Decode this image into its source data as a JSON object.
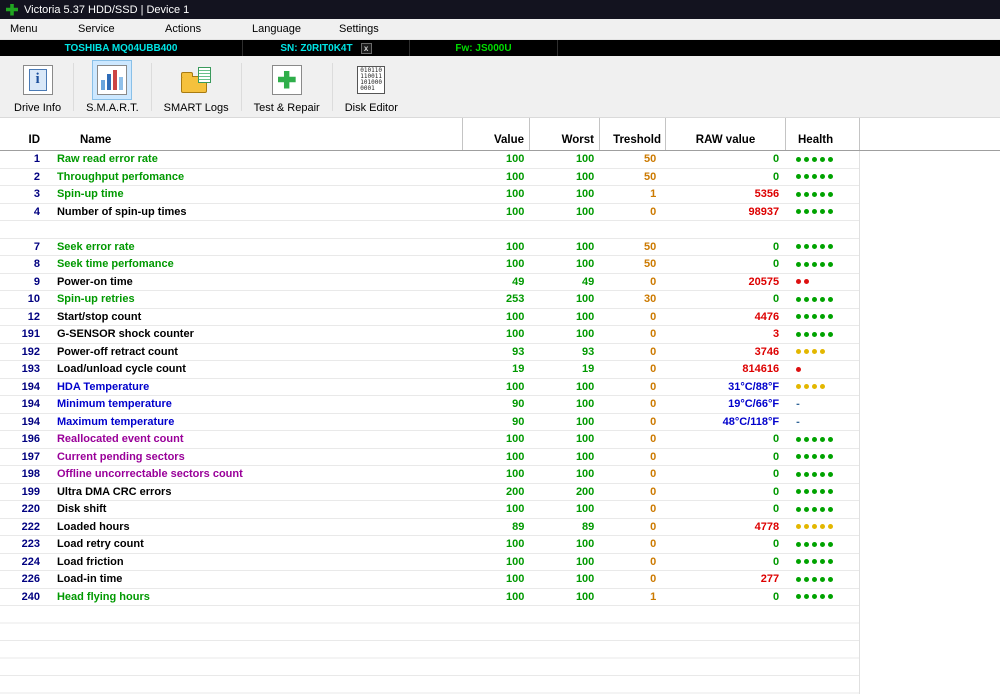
{
  "window": {
    "title": "Victoria 5.37 HDD/SSD | Device 1"
  },
  "menu": {
    "items": [
      "Menu",
      "Service",
      "Actions",
      "Language",
      "Settings"
    ]
  },
  "drive_bar": {
    "model": "TOSHIBA MQ04UBB400",
    "serial": "SN: Z0RIT0K4T",
    "close": "x",
    "firmware": "Fw: JS000U"
  },
  "toolbar": {
    "buttons": [
      {
        "label": "Drive Info",
        "icon": "info-icon",
        "glyph": "i"
      },
      {
        "label": "S.M.A.R.T.",
        "icon": "smart-chart-icon",
        "selected": true
      },
      {
        "label": "SMART Logs",
        "icon": "folder-logs-icon"
      },
      {
        "label": "Test & Repair",
        "icon": "repair-cross-icon"
      },
      {
        "label": "Disk Editor",
        "icon": "binary-editor-icon",
        "icon_text": [
          "010110",
          "110011",
          "101000",
          "0001"
        ]
      }
    ]
  },
  "table": {
    "headers": [
      "ID",
      "Name",
      "Value",
      "Worst",
      "Treshold",
      "RAW value",
      "Health"
    ],
    "rows": [
      {
        "id": "1",
        "name": "Raw read error rate",
        "name_color": "green",
        "value": "100",
        "worst": "100",
        "threshold": "50",
        "raw": "0",
        "raw_color": "green",
        "health": {
          "dots": 5,
          "color": "green"
        }
      },
      {
        "id": "2",
        "name": "Throughput perfomance",
        "name_color": "green",
        "value": "100",
        "worst": "100",
        "threshold": "50",
        "raw": "0",
        "raw_color": "green",
        "health": {
          "dots": 5,
          "color": "green"
        }
      },
      {
        "id": "3",
        "name": "Spin-up time",
        "name_color": "green",
        "value": "100",
        "worst": "100",
        "threshold": "1",
        "raw": "5356",
        "raw_color": "red",
        "health": {
          "dots": 5,
          "color": "green"
        }
      },
      {
        "id": "4",
        "name": "Number of spin-up times",
        "name_color": "black",
        "value": "100",
        "worst": "100",
        "threshold": "0",
        "raw": "98937",
        "raw_color": "red",
        "health": {
          "dots": 5,
          "color": "green"
        }
      },
      {
        "spacer": true
      },
      {
        "id": "7",
        "name": "Seek error rate",
        "name_color": "green",
        "value": "100",
        "worst": "100",
        "threshold": "50",
        "raw": "0",
        "raw_color": "green",
        "health": {
          "dots": 5,
          "color": "green"
        }
      },
      {
        "id": "8",
        "name": "Seek time perfomance",
        "name_color": "green",
        "value": "100",
        "worst": "100",
        "threshold": "50",
        "raw": "0",
        "raw_color": "green",
        "health": {
          "dots": 5,
          "color": "green"
        }
      },
      {
        "id": "9",
        "name": "Power-on time",
        "name_color": "black",
        "value": "49",
        "worst": "49",
        "threshold": "0",
        "raw": "20575",
        "raw_color": "red",
        "health": {
          "dots": 2,
          "color": "red"
        }
      },
      {
        "id": "10",
        "name": "Spin-up retries",
        "name_color": "green",
        "value": "253",
        "worst": "100",
        "threshold": "30",
        "raw": "0",
        "raw_color": "green",
        "health": {
          "dots": 5,
          "color": "green"
        }
      },
      {
        "id": "12",
        "name": "Start/stop count",
        "name_color": "black",
        "value": "100",
        "worst": "100",
        "threshold": "0",
        "raw": "4476",
        "raw_color": "red",
        "health": {
          "dots": 5,
          "color": "green"
        }
      },
      {
        "id": "191",
        "name": "G-SENSOR shock counter",
        "name_color": "black",
        "value": "100",
        "worst": "100",
        "threshold": "0",
        "raw": "3",
        "raw_color": "red",
        "health": {
          "dots": 5,
          "color": "green"
        }
      },
      {
        "id": "192",
        "name": "Power-off retract count",
        "name_color": "black",
        "value": "93",
        "worst": "93",
        "threshold": "0",
        "raw": "3746",
        "raw_color": "red",
        "health": {
          "dots": 4,
          "color": "yellow"
        }
      },
      {
        "id": "193",
        "name": "Load/unload cycle count",
        "name_color": "black",
        "value": "19",
        "worst": "19",
        "threshold": "0",
        "raw": "814616",
        "raw_color": "red",
        "health": {
          "dots": 1,
          "color": "red"
        }
      },
      {
        "id": "194",
        "name": "HDA Temperature",
        "name_color": "blue",
        "value": "100",
        "worst": "100",
        "threshold": "0",
        "raw": "31°C/88°F",
        "raw_color": "blue",
        "health": {
          "dots": 4,
          "color": "yellow"
        }
      },
      {
        "id": "194",
        "name": "Minimum temperature",
        "name_color": "blue",
        "value": "90",
        "worst": "100",
        "threshold": "0",
        "raw": "19°C/66°F",
        "raw_color": "blue",
        "health": {
          "dash": true
        }
      },
      {
        "id": "194",
        "name": "Maximum temperature",
        "name_color": "blue",
        "value": "90",
        "worst": "100",
        "threshold": "0",
        "raw": "48°C/118°F",
        "raw_color": "blue",
        "health": {
          "dash": true
        }
      },
      {
        "id": "196",
        "name": "Reallocated event count",
        "name_color": "purple",
        "value": "100",
        "worst": "100",
        "threshold": "0",
        "raw": "0",
        "raw_color": "green",
        "health": {
          "dots": 5,
          "color": "green"
        }
      },
      {
        "id": "197",
        "name": "Current pending sectors",
        "name_color": "purple",
        "value": "100",
        "worst": "100",
        "threshold": "0",
        "raw": "0",
        "raw_color": "green",
        "health": {
          "dots": 5,
          "color": "green"
        }
      },
      {
        "id": "198",
        "name": "Offline uncorrectable sectors count",
        "name_color": "purple",
        "value": "100",
        "worst": "100",
        "threshold": "0",
        "raw": "0",
        "raw_color": "green",
        "health": {
          "dots": 5,
          "color": "green"
        }
      },
      {
        "id": "199",
        "name": "Ultra DMA CRC errors",
        "name_color": "black",
        "value": "200",
        "worst": "200",
        "threshold": "0",
        "raw": "0",
        "raw_color": "green",
        "health": {
          "dots": 5,
          "color": "green"
        }
      },
      {
        "id": "220",
        "name": "Disk shift",
        "name_color": "black",
        "value": "100",
        "worst": "100",
        "threshold": "0",
        "raw": "0",
        "raw_color": "green",
        "health": {
          "dots": 5,
          "color": "green"
        }
      },
      {
        "id": "222",
        "name": "Loaded hours",
        "name_color": "black",
        "value": "89",
        "worst": "89",
        "threshold": "0",
        "raw": "4778",
        "raw_color": "red",
        "health": {
          "dots": 5,
          "color": "yellow"
        }
      },
      {
        "id": "223",
        "name": "Load retry count",
        "name_color": "black",
        "value": "100",
        "worst": "100",
        "threshold": "0",
        "raw": "0",
        "raw_color": "green",
        "health": {
          "dots": 5,
          "color": "green"
        }
      },
      {
        "id": "224",
        "name": "Load friction",
        "name_color": "black",
        "value": "100",
        "worst": "100",
        "threshold": "0",
        "raw": "0",
        "raw_color": "green",
        "health": {
          "dots": 5,
          "color": "green"
        }
      },
      {
        "id": "226",
        "name": "Load-in time",
        "name_color": "black",
        "value": "100",
        "worst": "100",
        "threshold": "0",
        "raw": "277",
        "raw_color": "red",
        "health": {
          "dots": 5,
          "color": "green"
        }
      },
      {
        "id": "240",
        "name": "Head flying hours",
        "name_color": "green",
        "value": "100",
        "worst": "100",
        "threshold": "1",
        "raw": "0",
        "raw_color": "green",
        "health": {
          "dots": 5,
          "color": "green"
        }
      }
    ]
  },
  "colors": {
    "id": "#000080",
    "green": "#009900",
    "black": "#000000",
    "blue": "#0000cc",
    "purple": "#990099",
    "red": "#dd0000",
    "value": "#009900",
    "threshold": "#cc7a00",
    "dot_green": "#00a300",
    "dot_red": "#dd1111",
    "dot_yellow": "#e3b700",
    "dash": "#336699",
    "model_cyan": "#00e5e5",
    "firmware_green": "#00dd00"
  }
}
